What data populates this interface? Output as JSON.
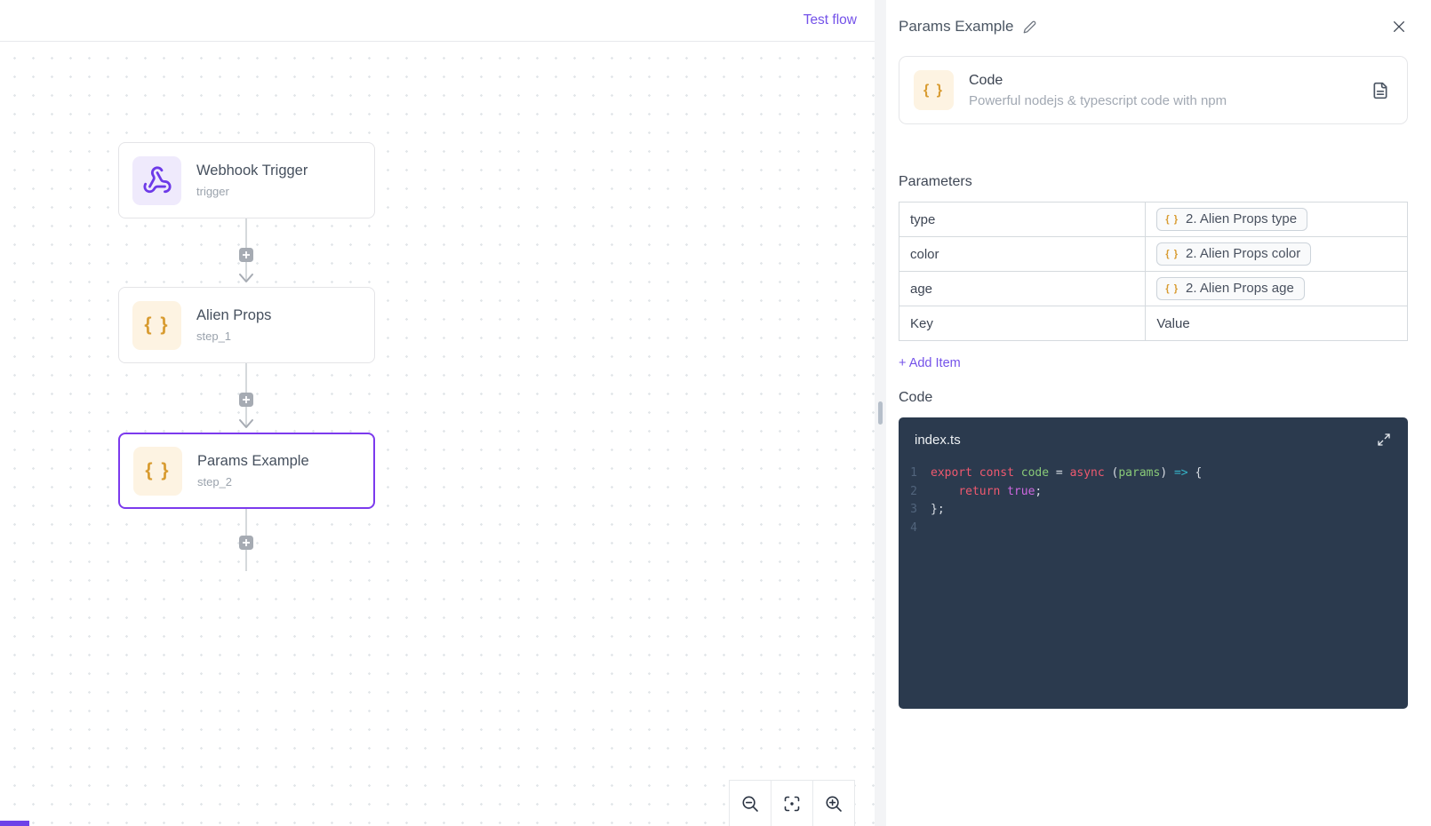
{
  "topbar": {
    "test_flow_label": "Test flow"
  },
  "canvas": {
    "nodes": [
      {
        "title": "Webhook Trigger",
        "subtitle": "trigger",
        "icon": "webhook-icon",
        "selected": false
      },
      {
        "title": "Alien Props",
        "subtitle": "step_1",
        "icon": "braces-icon",
        "selected": false
      },
      {
        "title": "Params Example",
        "subtitle": "step_2",
        "icon": "braces-icon",
        "selected": true
      }
    ],
    "zoom_controls": [
      "zoom-out",
      "fit-view",
      "zoom-in"
    ]
  },
  "panel": {
    "title": "Params Example",
    "piece": {
      "name": "Code",
      "description": "Powerful nodejs & typescript code with npm",
      "icon": "braces-icon",
      "action_icon": "file-text-icon"
    },
    "parameters": {
      "heading": "Parameters",
      "rows": [
        {
          "key": "type",
          "value": "2. Alien Props type"
        },
        {
          "key": "color",
          "value": "2. Alien Props color"
        },
        {
          "key": "age",
          "value": "2. Alien Props age"
        }
      ],
      "key_placeholder": "Key",
      "value_placeholder": "Value",
      "add_item_label": "+ Add Item"
    },
    "code": {
      "heading": "Code",
      "filename": "index.ts",
      "lines": [
        {
          "n": "1",
          "text": "export const code = async (params) => {",
          "tokens": [
            [
              "kw",
              "export"
            ],
            [
              "pl",
              " "
            ],
            [
              "kw",
              "const"
            ],
            [
              "pl",
              " "
            ],
            [
              "var",
              "code"
            ],
            [
              "pl",
              " = "
            ],
            [
              "kw",
              "async"
            ],
            [
              "pl",
              " ("
            ],
            [
              "var",
              "params"
            ],
            [
              "pl",
              ") "
            ],
            [
              "ar",
              "=>"
            ],
            [
              "pl",
              " {"
            ]
          ]
        },
        {
          "n": "2",
          "text": "    return true;",
          "tokens": [
            [
              "pl",
              "    "
            ],
            [
              "kw",
              "return"
            ],
            [
              "pl",
              " "
            ],
            [
              "bool",
              "true"
            ],
            [
              "pl",
              ";"
            ]
          ]
        },
        {
          "n": "3",
          "text": "};",
          "tokens": [
            [
              "pl",
              "};"
            ]
          ]
        },
        {
          "n": "4",
          "text": "",
          "tokens": []
        }
      ]
    }
  },
  "glyphs": {
    "braces": "{ }"
  },
  "colors": {
    "accent_link": "#7452e9",
    "selected_border": "#7c3aed",
    "amber": "#d89b30",
    "amber_bg": "#fdf3e2",
    "webhook_purple": "#6d3ae8",
    "webhook_bg": "#efeafc",
    "editor_bg": "#2b3a4e",
    "token_keyword": "#ef596f",
    "token_identifier": "#89ca78",
    "token_arrow": "#35b3c8",
    "token_boolean": "#cf68e1"
  }
}
